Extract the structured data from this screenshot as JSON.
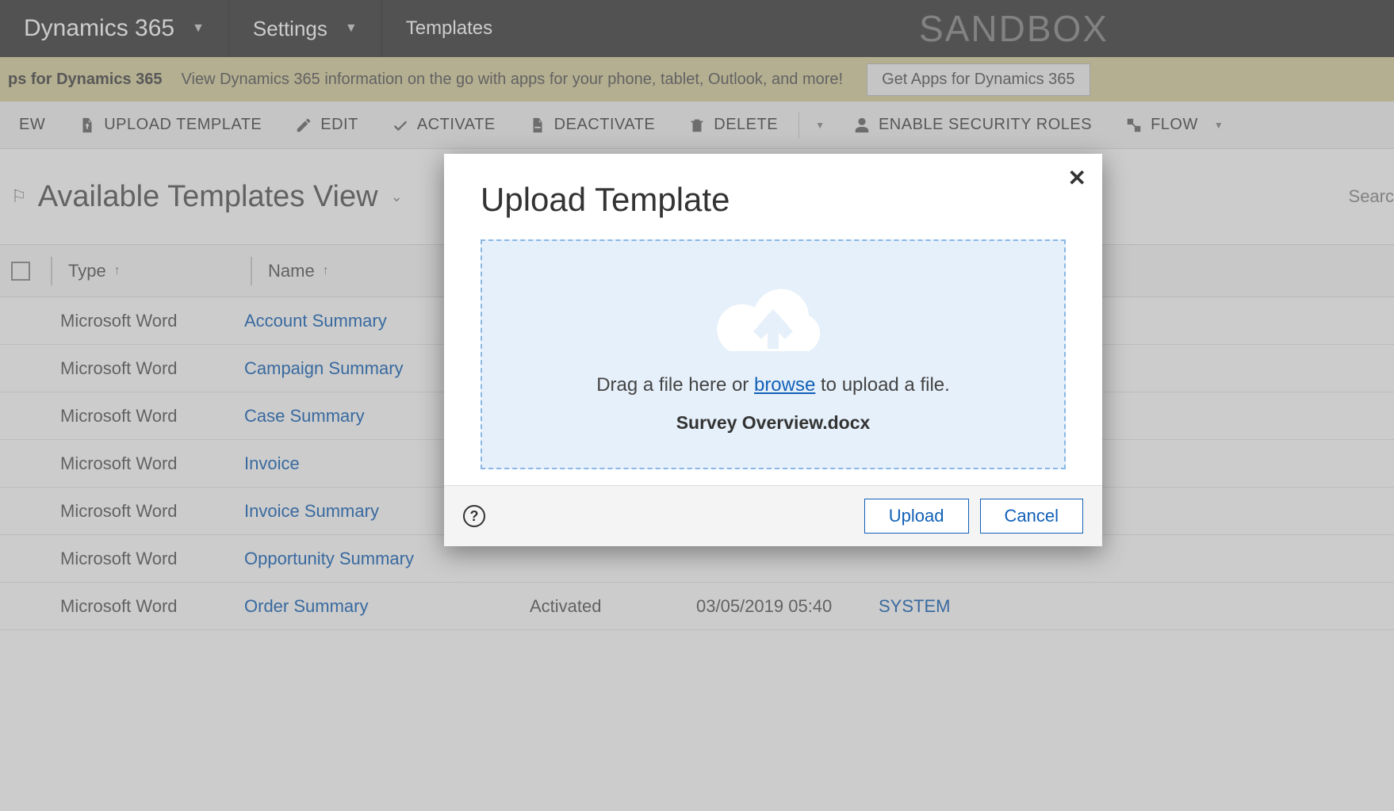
{
  "topnav": {
    "brand": "Dynamics 365",
    "area": "Settings",
    "sub": "Templates",
    "env": "SANDBOX"
  },
  "banner": {
    "title": "ps for Dynamics 365",
    "desc": "View Dynamics 365 information on the go with apps for your phone, tablet, Outlook, and more!",
    "button": "Get Apps for Dynamics 365"
  },
  "commands": {
    "new": "EW",
    "upload": "UPLOAD TEMPLATE",
    "edit": "EDIT",
    "activate": "ACTIVATE",
    "deactivate": "DEACTIVATE",
    "delete": "DELETE",
    "security": "ENABLE SECURITY ROLES",
    "flow": "FLOW"
  },
  "view": {
    "title": "Available Templates View",
    "search_placeholder": "Searc"
  },
  "columns": {
    "type": "Type",
    "name": "Name",
    "status": "",
    "modified_on": "",
    "modified_by": ""
  },
  "rows": [
    {
      "type": "Microsoft Word",
      "name": "Account Summary",
      "status": "",
      "modon": "",
      "modby": ""
    },
    {
      "type": "Microsoft Word",
      "name": "Campaign Summary",
      "status": "",
      "modon": "",
      "modby": ""
    },
    {
      "type": "Microsoft Word",
      "name": "Case Summary",
      "status": "",
      "modon": "",
      "modby": ""
    },
    {
      "type": "Microsoft Word",
      "name": "Invoice",
      "status": "",
      "modon": "",
      "modby": ""
    },
    {
      "type": "Microsoft Word",
      "name": "Invoice Summary",
      "status": "",
      "modon": "",
      "modby": ""
    },
    {
      "type": "Microsoft Word",
      "name": "Opportunity Summary",
      "status": "",
      "modon": "",
      "modby": ""
    },
    {
      "type": "Microsoft Word",
      "name": "Order Summary",
      "status": "Activated",
      "modon": "03/05/2019 05:40",
      "modby": "SYSTEM"
    }
  ],
  "modal": {
    "title": "Upload Template",
    "drag_pre": "Drag a file here or ",
    "browse": "browse",
    "drag_post": " to upload a file.",
    "file": "Survey Overview.docx",
    "upload": "Upload",
    "cancel": "Cancel"
  }
}
